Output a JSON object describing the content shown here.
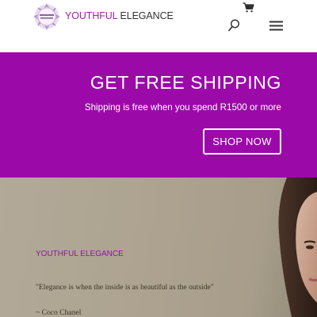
{
  "header": {
    "logo": {
      "brand_part_1": "YOUTHFUL",
      "brand_part_2": " ELEGANCE",
      "emblem_text": "YOUTHFUL & ELEGANCE",
      "accent_color": "#a81bb2"
    },
    "icons": [
      "shopping-cart-icon",
      "search-icon",
      "hamburger-menu-icon"
    ]
  },
  "promo": {
    "title": "GET FREE SHIPPING",
    "subtitle": "Shipping is free when you spend R1500 or more",
    "button_label": "SHOP NOW",
    "background_color": "#9b0aa9"
  },
  "hero": {
    "brand": "YOUTHFUL ELEGANCE",
    "quote": "\"Elegance is when the inside is as beautiful as the outside\"",
    "author": "~ Coco Chanel"
  }
}
